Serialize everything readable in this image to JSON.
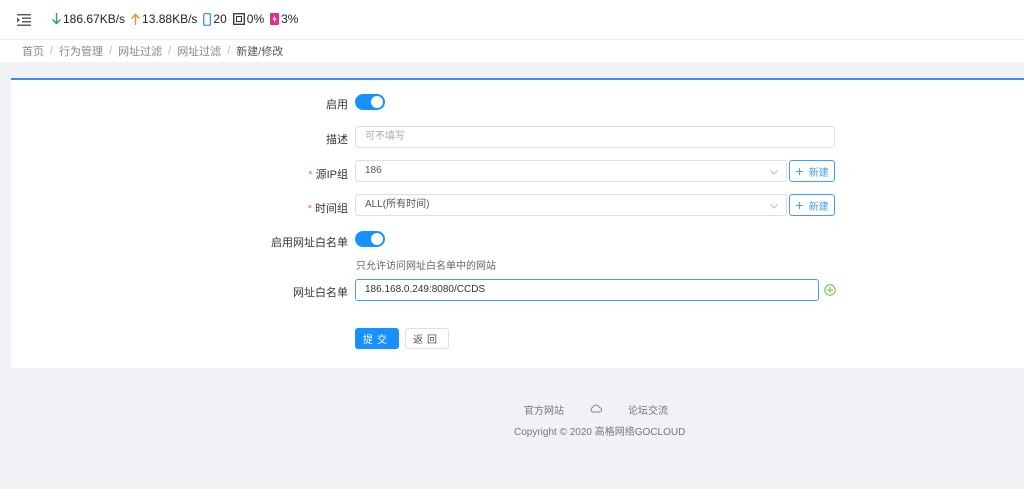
{
  "stats": {
    "download": "186.67KB/s",
    "upload": "13.88KB/s",
    "devices": "20",
    "cpu": "0%",
    "memory": "3%"
  },
  "breadcrumb": [
    "首页",
    "行为管理",
    "网址过滤",
    "网址过滤",
    "新建/修改"
  ],
  "form": {
    "enable_label": "启用",
    "desc_label": "描述",
    "desc_placeholder": "可不填写",
    "source_ip_label": "源IP组",
    "source_ip_value": "186",
    "time_group_label": "时间组",
    "time_group_value": "ALL(所有时间)",
    "new_button": "新建",
    "whitelist_enable_label": "启用网址白名单",
    "whitelist_hint": "只允许访问网址白名单中的网站",
    "whitelist_label": "网址白名单",
    "whitelist_value": "186.168.0.249:8080/CCDS",
    "submit": "提交",
    "back": "返回"
  },
  "footer": {
    "official_site": "官方网站",
    "forum": "论坛交流",
    "copyright": "Copyright © 2020 高格网络GOCLOUD"
  },
  "colors": {
    "primary": "#1890ff",
    "download_arrow": "#2e9e4f",
    "upload_arrow": "#f08c28",
    "device_icon": "#1890ff",
    "memory_icon": "#e0308a",
    "required": "#f56c6c",
    "add_circle": "#67c23a"
  }
}
